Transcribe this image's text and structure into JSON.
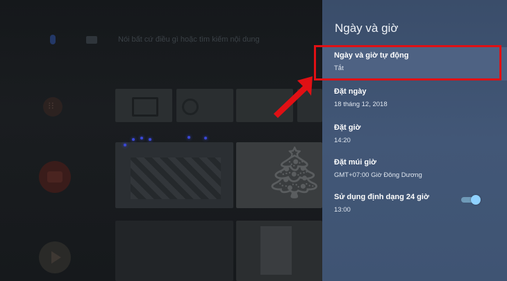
{
  "background": {
    "search_hint": "Nói bất cứ điều gì hoặc tìm kiếm nội dung"
  },
  "panel": {
    "title": "Ngày và giờ",
    "items": [
      {
        "label": "Ngày và giờ tự động",
        "value": "Tắt"
      },
      {
        "label": "Đặt ngày",
        "value": "18 tháng 12, 2018"
      },
      {
        "label": "Đặt giờ",
        "value": "14:20"
      },
      {
        "label": "Đặt múi giờ",
        "value": "GMT+07:00 Giờ Đông Dương"
      },
      {
        "label": "Sử dụng định dạng 24 giờ",
        "value": "13:00"
      }
    ],
    "toggle_24h_on": true
  },
  "colors": {
    "panel_bg": "#425777",
    "selected_item_bg": "#4e6283",
    "annotation": "#e01014",
    "toggle_knob": "#8fd1ff"
  }
}
